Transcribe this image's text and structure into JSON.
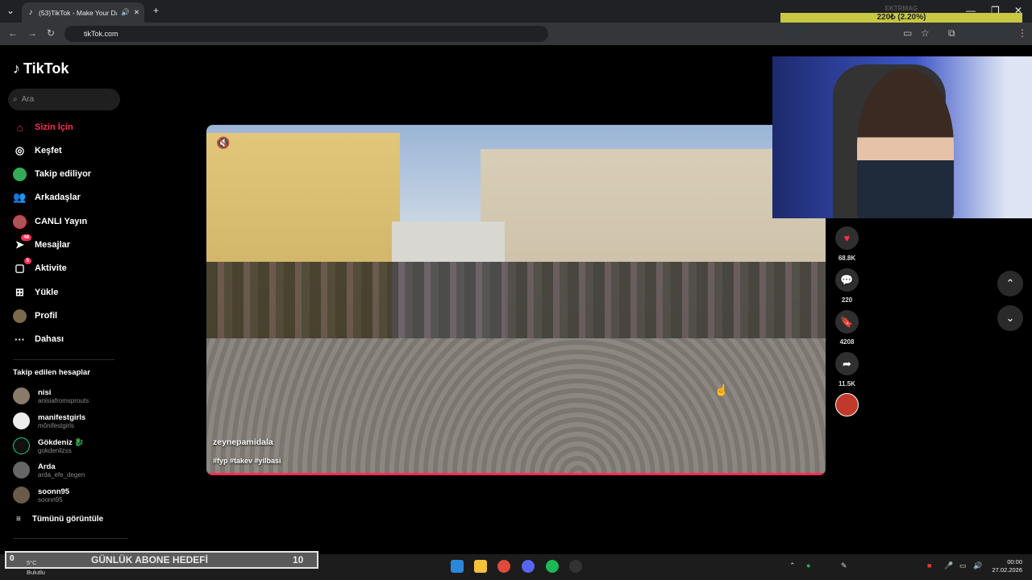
{
  "browser": {
    "tab_title": "(53)TikTok - Make Your Day",
    "url": "tikTok.com"
  },
  "stream_overlay": {
    "ticker_label": "EKTRMAG",
    "ticker_value": "220₺ (2.20%)",
    "left_amount": "TRY0",
    "right_amount": "TRY10000"
  },
  "sidebar": {
    "logo": "TikTok",
    "search_placeholder": "Ara",
    "nav": [
      {
        "label": "Sizin İçin",
        "icon": "home-icon"
      },
      {
        "label": "Keşfet",
        "icon": "compass-icon"
      },
      {
        "label": "Takip ediliyor",
        "icon": "following-avatar-icon"
      },
      {
        "label": "Arkadaşlar",
        "icon": "friends-icon"
      },
      {
        "label": "CANLI Yayın",
        "icon": "live-icon"
      },
      {
        "label": "Mesajlar",
        "icon": "messages-icon",
        "badge": "48"
      },
      {
        "label": "Aktivite",
        "icon": "activity-icon",
        "badge": "5"
      },
      {
        "label": "Yükle",
        "icon": "upload-icon"
      },
      {
        "label": "Profil",
        "icon": "profile-avatar-icon"
      },
      {
        "label": "Dahası",
        "icon": "more-icon"
      }
    ],
    "following_title": "Takip edilen hesaplar",
    "accounts": [
      {
        "name": "nisi",
        "handle": "anisiafromsprouts"
      },
      {
        "name": "manifestgirls",
        "handle": "mõnifestgirls"
      },
      {
        "name": "Gökdeniz 🐉",
        "handle": "gokdenilzss"
      },
      {
        "name": "Arda",
        "handle": "arda_efe_degen"
      },
      {
        "name": "soonn95",
        "handle": "soonn95"
      }
    ],
    "see_all": "Tümünü görüntüle"
  },
  "video": {
    "author": "zeynepamidala",
    "hashtags": "#fyp #takev #yilbasi"
  },
  "actions": {
    "likes": "68.8K",
    "comments": "220",
    "saves": "4208",
    "shares": "11.5K"
  },
  "taskbar": {
    "goal_label": "GÜNLÜK ABONE HEDEFİ",
    "goal_value": "10",
    "goal_current": "0",
    "weather_temp": "5°C",
    "weather_desc": "Bulutlu",
    "time": "00:00",
    "date": "27.02.2026"
  },
  "colors": {
    "accent": "#fe2c55",
    "background": "#000000"
  }
}
